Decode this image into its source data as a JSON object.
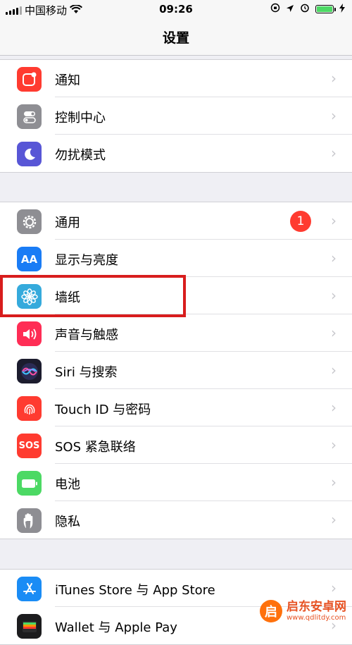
{
  "status_bar": {
    "carrier": "中国移动",
    "time": "09:26"
  },
  "nav": {
    "title": "设置"
  },
  "groups": [
    {
      "items": [
        {
          "label": "通知",
          "icon": "notifications-icon",
          "color": "#ff3b30"
        },
        {
          "label": "控制中心",
          "icon": "control-center-icon",
          "color": "#8e8e93"
        },
        {
          "label": "勿扰模式",
          "icon": "moon-icon",
          "color": "#5856d6"
        }
      ]
    },
    {
      "items": [
        {
          "label": "通用",
          "icon": "gear-icon",
          "color": "#8e8e93",
          "badge": "1"
        },
        {
          "label": "显示与亮度",
          "icon": "display-aa-icon",
          "color": "#1a7cf5",
          "icon_text": "AA"
        },
        {
          "label": "墙纸",
          "icon": "wallpaper-flower-icon",
          "color": "#35aadc"
        },
        {
          "label": "声音与触感",
          "icon": "speaker-icon",
          "color": "#ff2d55"
        },
        {
          "label": "Siri 与搜索",
          "icon": "siri-icon",
          "color": "#1c1c2e"
        },
        {
          "label": "Touch ID 与密码",
          "icon": "fingerprint-icon",
          "color": "#ff3b30"
        },
        {
          "label": "SOS 紧急联络",
          "icon": "sos-icon",
          "color": "#ff3b30",
          "icon_text": "SOS"
        },
        {
          "label": "电池",
          "icon": "battery-icon",
          "color": "#4cd964"
        },
        {
          "label": "隐私",
          "icon": "hand-icon",
          "color": "#8e8e93"
        }
      ]
    },
    {
      "items": [
        {
          "label": "iTunes Store 与 App Store",
          "icon": "app-store-icon",
          "color": "#1a8cf5"
        },
        {
          "label": "Wallet 与 Apple Pay",
          "icon": "wallet-icon",
          "color": "#1c1c1e"
        }
      ]
    }
  ],
  "watermark": {
    "title": "启东安卓网",
    "url": "www.qdlitdy.com",
    "logo_text": "启"
  }
}
